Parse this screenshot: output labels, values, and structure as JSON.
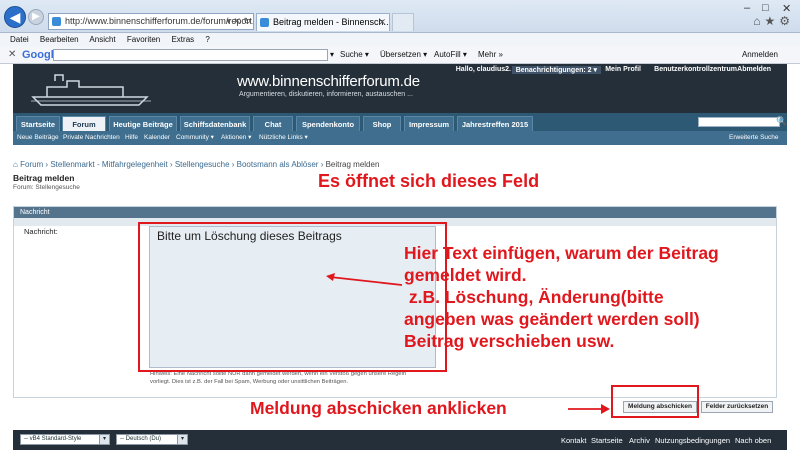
{
  "browser": {
    "address": "http://www.binnenschifferforum.de/forum/report.php",
    "tab_title": "Beitrag melden - Binnensch...",
    "menu": [
      "Datei",
      "Bearbeiten",
      "Ansicht",
      "Favoriten",
      "Extras",
      "?"
    ],
    "toolbar": {
      "google_label": "Google",
      "suche": "Suche ▾",
      "uebersetzen": "Übersetzen ▾",
      "autofill": "AutoFill ▾",
      "mehr": "Mehr »",
      "anmelden": "Anmelden"
    }
  },
  "site": {
    "title": "www.binnenschifferforum.de",
    "subtitle": "Argumentieren, diskutieren, informieren, austauschen ...",
    "user": {
      "hello": "Hallo, claudius2.",
      "notifications": "Benachrichtigungen: 2 ▾",
      "profile": "Mein Profil",
      "control": "Benutzerkontrollzentrum",
      "logout": "Abmelden"
    },
    "nav_tabs": [
      "Startseite",
      "Forum",
      "Heutige Beiträge",
      "Schiffsdatenbank",
      "Chat",
      "Spendenkonto",
      "Shop",
      "Impressum",
      "Jahrestreffen 2015"
    ],
    "sub_nav": [
      "Neue Beiträge",
      "Private Nachrichten",
      "Hilfe",
      "Kalender",
      "Community ▾",
      "Aktionen ▾",
      "Nützliche Links ▾"
    ],
    "advanced_search": "Erweiterte Suche"
  },
  "breadcrumb": [
    "Forum",
    "Stellenmarkt - Mitfahrgelegenheit",
    "Stellengesuche",
    "Bootsmann als Ablöser",
    "Beitrag melden"
  ],
  "page": {
    "title": "Beitrag melden",
    "subtitle": "Forum: Stellengesuche",
    "panel_title": "Nachricht",
    "field_label": "Nachricht:",
    "textarea_value": "Bitte um Löschung dieses Beitrags",
    "hint_line1": "Hinweis: Eine Nachricht sollte NUR dann gemeldet werden, wenn ein Verstoß gegen unsere Regeln",
    "hint_line2": "vorliegt. Dies ist z.B. der Fall bei Spam, Werbung oder unsittlichen Beiträgen.",
    "submit": "Meldung abschicken",
    "reset": "Felder zurücksetzen"
  },
  "annotations": {
    "top": "Es öffnet sich dieses Feld",
    "explain": [
      "Hier Text einfügen, warum der Beitrag",
      "gemeldet wird.",
      " z.B. Löschung, Änderung(bitte",
      "angeben was geändert werden soll)",
      "Beitrag verschieben usw."
    ],
    "button": "Meldung abschicken anklicken"
  },
  "footer": {
    "style": "-- vB4 Standard-Style",
    "language": "-- Deutsch (Du)",
    "links": [
      "Kontakt",
      "Startseite",
      "Archiv",
      "Nutzungsbedingungen",
      "Nach oben"
    ]
  },
  "colors": {
    "header_bg": "#242f3a",
    "nav_bg": "#2e5975",
    "annotation_red": "#e0181e"
  }
}
